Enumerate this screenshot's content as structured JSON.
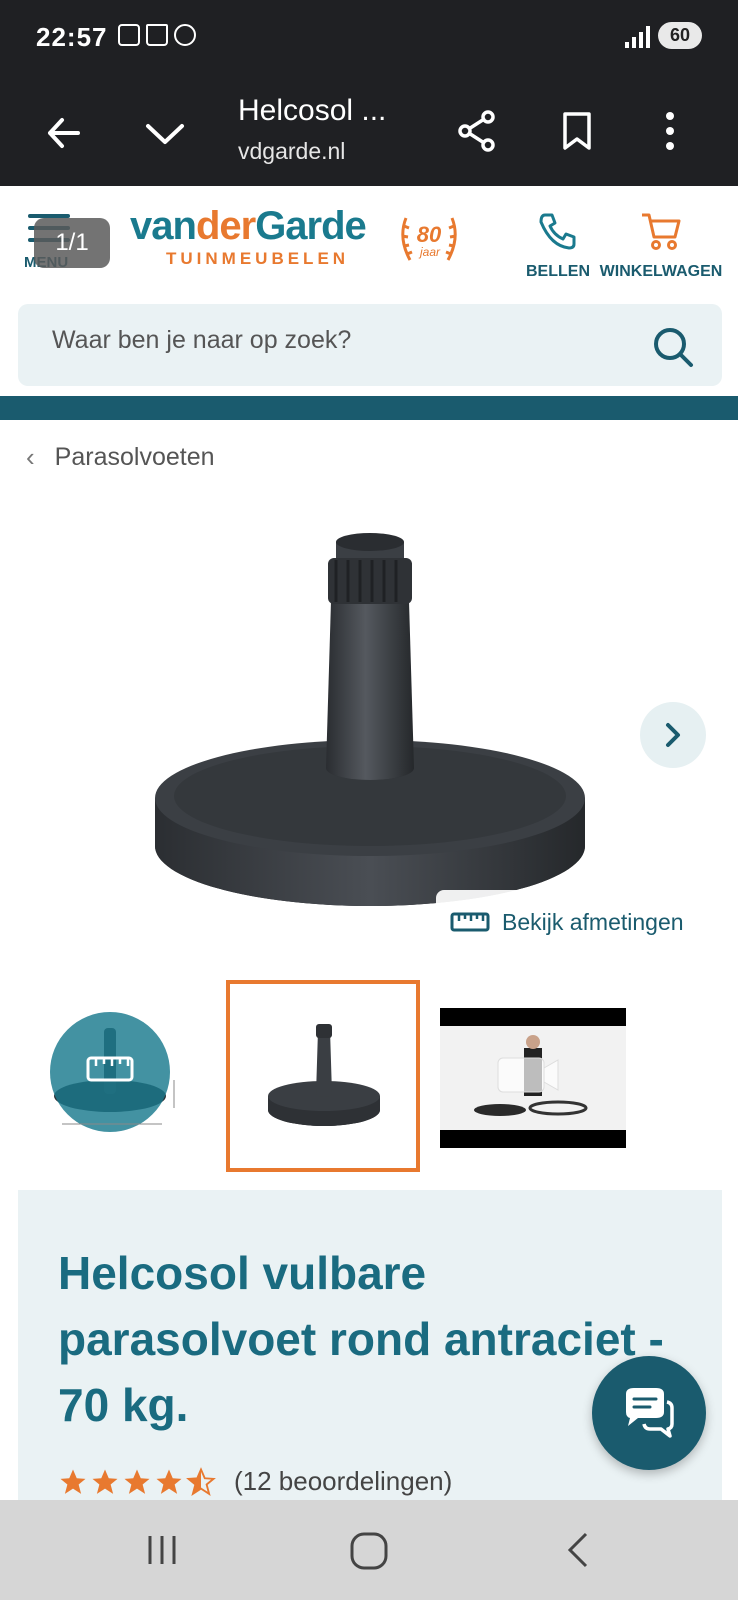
{
  "status_bar": {
    "time": "22:57",
    "battery": "60"
  },
  "browser": {
    "title": "Helcosol ...",
    "url": "vdgarde.nl",
    "tab_counter": "1/1"
  },
  "header": {
    "menu_label": "MENU",
    "logo_van": "van",
    "logo_der": "der",
    "logo_garde": "Garde",
    "logo_sub": "TUINMEUBELEN",
    "logo_badge_number": "80",
    "logo_badge_text": "jaar",
    "call_label": "BELLEN",
    "cart_label": "WINKELWAGEN"
  },
  "search": {
    "placeholder": "Waar ben je naar op zoek?"
  },
  "breadcrumb": {
    "label": "Parasolvoeten"
  },
  "gallery": {
    "dimensions_label": "Bekijk afmetingen"
  },
  "product": {
    "title": "Helcosol vulbare parasolvoet rond antraciet - 70 kg.",
    "rating": 4.5,
    "rating_text": "(12 beoordelingen)"
  },
  "colors": {
    "brand_teal": "#1a5b6e",
    "brand_orange": "#e8792f",
    "card_bg": "#eaf2f4"
  }
}
